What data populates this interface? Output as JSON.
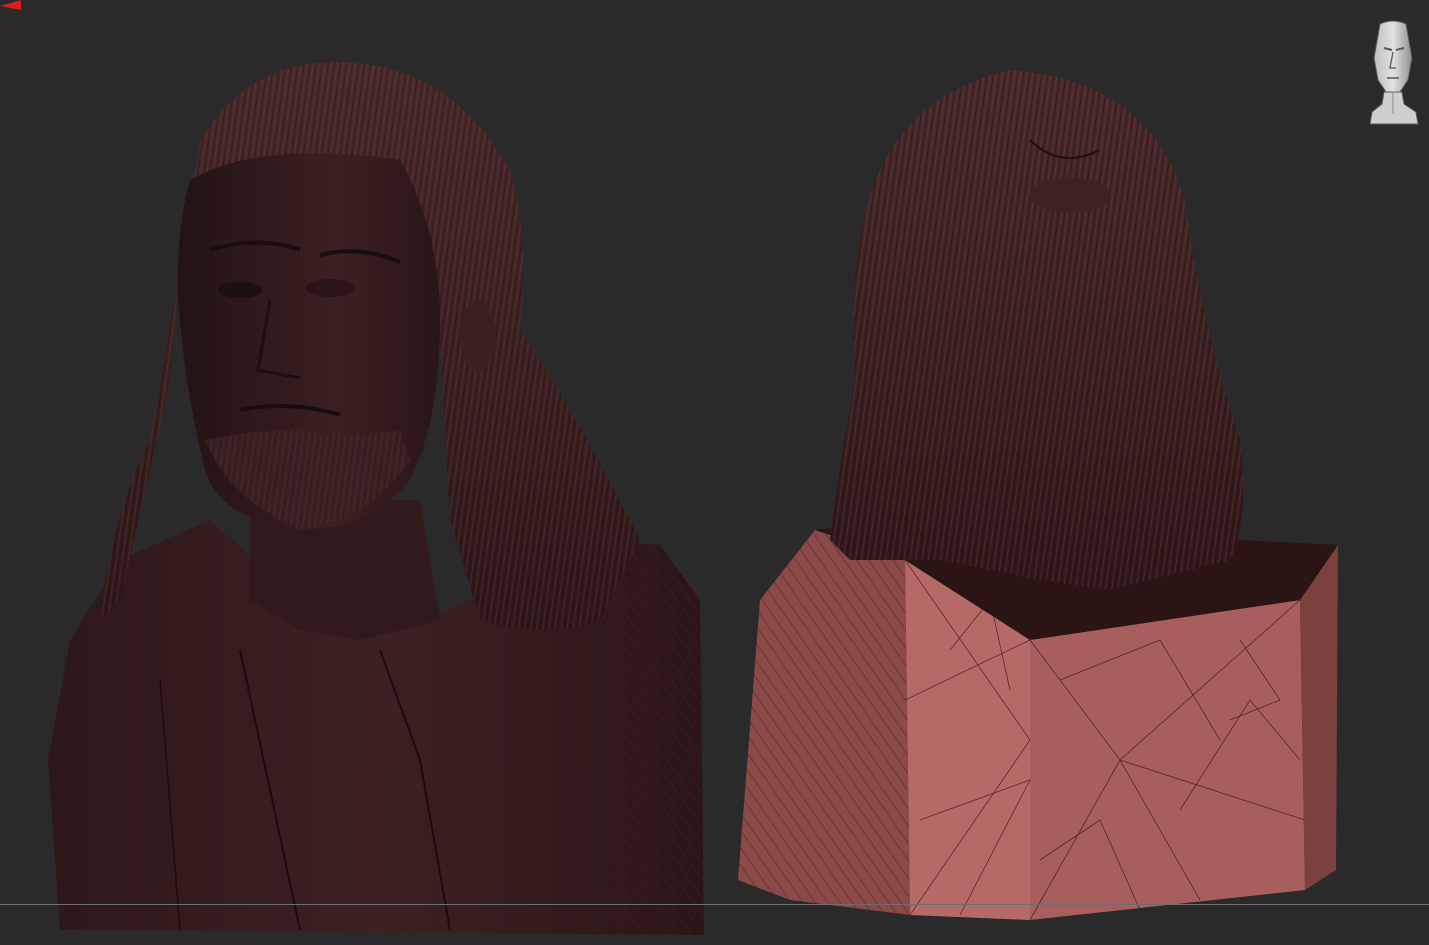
{
  "viewport": {
    "background": "#2a2a2a",
    "material_color": "#5a2f30",
    "material_highlight": "#8a4c4c",
    "cap_color": "#b76a67",
    "wire_color": "#3a1a1b"
  },
  "navigation": {
    "icon": "head-orientation-icon",
    "indicator_color": "#d81e1e"
  }
}
